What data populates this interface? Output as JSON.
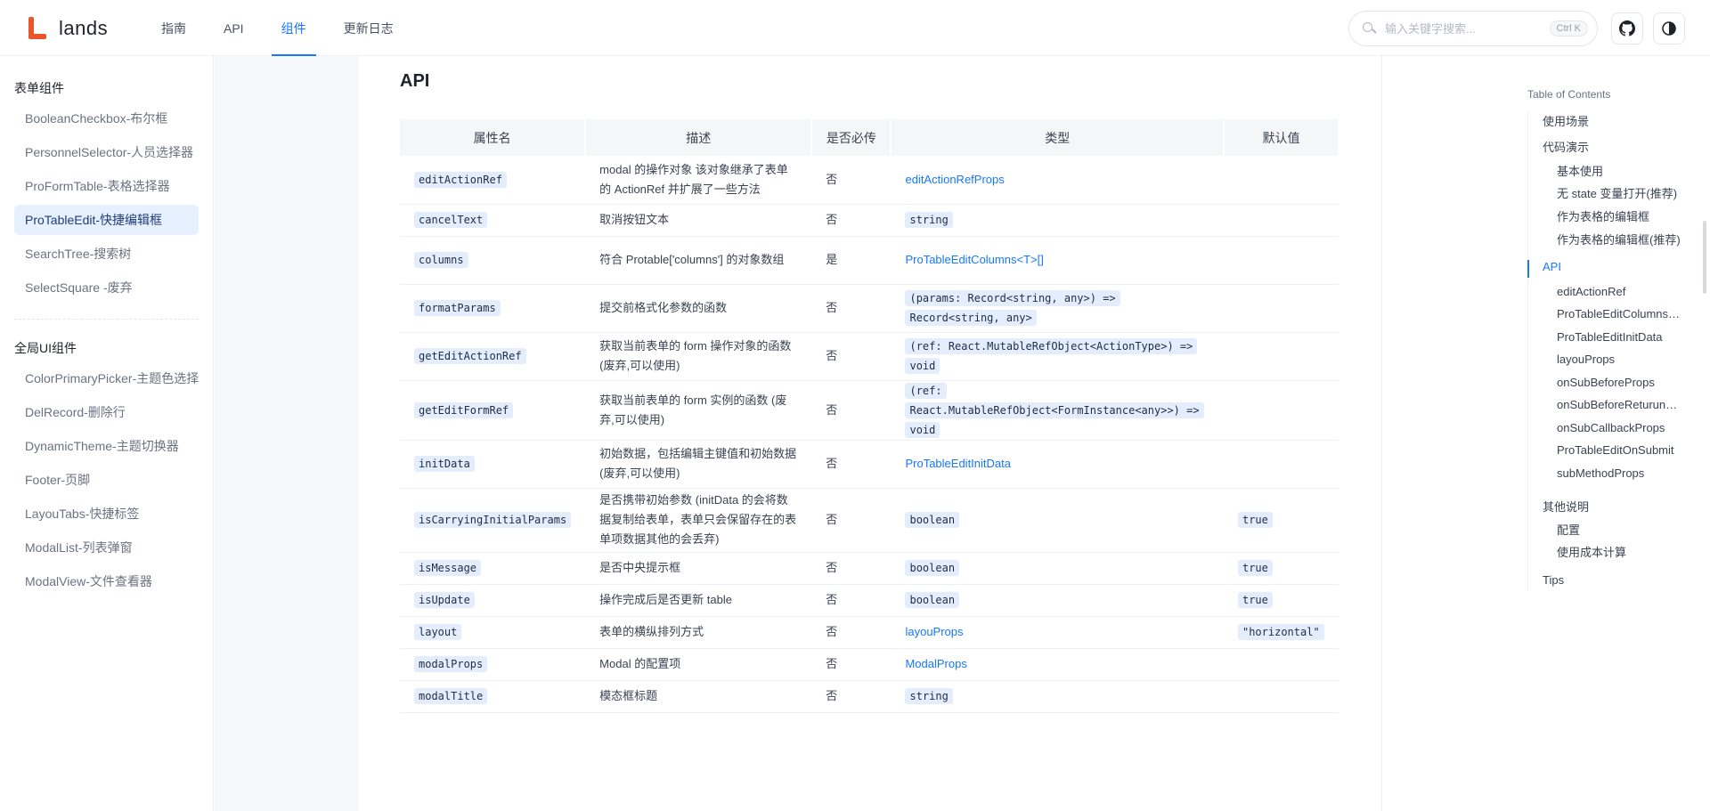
{
  "header": {
    "logo_text": "lands",
    "nav": [
      {
        "label": "指南",
        "active": false
      },
      {
        "label": "API",
        "active": false
      },
      {
        "label": "组件",
        "active": true
      },
      {
        "label": "更新日志",
        "active": false
      }
    ],
    "search_placeholder": "输入关键字搜索...",
    "search_shortcut": "Ctrl K",
    "github_icon": "github-icon",
    "theme_icon": "theme-toggle-icon"
  },
  "sidebar": {
    "group1_title": "表单组件",
    "group1_items": [
      "BooleanCheckbox-布尔框",
      "PersonnelSelector-人员选择器",
      "ProFormTable-表格选择器",
      "ProTableEdit-快捷编辑框",
      "SearchTree-搜索树",
      "SelectSquare -废弃"
    ],
    "active_item": "ProTableEdit-快捷编辑框",
    "group2_title": "全局UI组件",
    "group2_items": [
      "ColorPrimaryPicker-主题色选择器",
      "DelRecord-删除行",
      "DynamicTheme-主题切换器",
      "Footer-页脚",
      "LayouTabs-快捷标签",
      "ModalList-列表弹窗",
      "ModalView-文件查看器"
    ]
  },
  "main": {
    "section_title": "API",
    "table": {
      "headers": [
        "属性名",
        "描述",
        "是否必传",
        "类型",
        "默认值"
      ],
      "rows": [
        {
          "name": "editActionRef",
          "desc": "modal 的操作对象 该对象继承了表单的 ActionRef 并扩展了一些方法",
          "required": "否",
          "type": "editActionRefProps",
          "type_kind": "link",
          "default": ""
        },
        {
          "name": "cancelText",
          "desc": "取消按钮文本",
          "required": "否",
          "type": "string",
          "type_kind": "code",
          "default": ""
        },
        {
          "name": "columns",
          "desc": "符合 Protable['columns'] 的对象数组",
          "required": "是",
          "type": "ProTableEditColumns<T>[]",
          "type_kind": "link",
          "default": ""
        },
        {
          "name": "formatParams",
          "desc": "提交前格式化参数的函数",
          "required": "否",
          "type": "(params: Record<string, any>) => Record<string, any>",
          "type_kind": "code",
          "default": ""
        },
        {
          "name": "getEditActionRef",
          "desc": "获取当前表单的 form 操作对象的函数 (废弃,可以使用)",
          "required": "否",
          "type": "(ref: React.MutableRefObject<ActionType>) => void",
          "type_kind": "code",
          "default": ""
        },
        {
          "name": "getEditFormRef",
          "desc": "获取当前表单的 form 实例的函数 (废弃,可以使用)",
          "required": "否",
          "type": "(ref: React.MutableRefObject<FormInstance<any>>) => void",
          "type_kind": "code",
          "default": ""
        },
        {
          "name": "initData",
          "desc": "初始数据，包括编辑主键值和初始数据 (废弃,可以使用)",
          "required": "否",
          "type": "ProTableEditInitData",
          "type_kind": "link",
          "default": ""
        },
        {
          "name": "isCarryingInitialParams",
          "desc": "是否携带初始参数 (initData 的会将数据复制给表单，表单只会保留存在的表单项数据其他的会丢弃)",
          "required": "否",
          "type": "boolean",
          "type_kind": "code",
          "default": "true"
        },
        {
          "name": "isMessage",
          "desc": "是否中央提示框",
          "required": "否",
          "type": "boolean",
          "type_kind": "code",
          "default": "true"
        },
        {
          "name": "isUpdate",
          "desc": "操作完成后是否更新 table",
          "required": "否",
          "type": "boolean",
          "type_kind": "code",
          "default": "true"
        },
        {
          "name": "layout",
          "desc": "表单的横纵排列方式",
          "required": "否",
          "type": "layouProps",
          "type_kind": "link",
          "default": "\"horizontal\""
        },
        {
          "name": "modalProps",
          "desc": "Modal 的配置项",
          "required": "否",
          "type": "ModalProps",
          "type_kind": "link",
          "default": ""
        },
        {
          "name": "modalTitle",
          "desc": "模态框标题",
          "required": "否",
          "type": "string",
          "type_kind": "code",
          "default": ""
        }
      ]
    }
  },
  "toc": {
    "title": "Table of Contents",
    "items": [
      {
        "label": "使用场景",
        "level": 1
      },
      {
        "label": "代码演示",
        "level": 1
      },
      {
        "label": "基本使用",
        "level": 2
      },
      {
        "label": "无 state 变量打开(推荐)",
        "level": 2
      },
      {
        "label": "作为表格的编辑框",
        "level": 2
      },
      {
        "label": "作为表格的编辑框(推荐)",
        "level": 2
      },
      {
        "label": "API",
        "level": 1,
        "active": true
      },
      {
        "label": "editActionRef",
        "level": 2
      },
      {
        "label": "ProTableEditColumnsProps",
        "level": 2
      },
      {
        "label": "ProTableEditInitData",
        "level": 2
      },
      {
        "label": "layouProps",
        "level": 2
      },
      {
        "label": "onSubBeforeProps",
        "level": 2
      },
      {
        "label": "onSubBeforeReturunProps",
        "level": 2
      },
      {
        "label": "onSubCallbackProps",
        "level": 2
      },
      {
        "label": "ProTableEditOnSubmit",
        "level": 2
      },
      {
        "label": "subMethodProps",
        "level": 2
      },
      {
        "label": "其他说明",
        "level": 1
      },
      {
        "label": "配置",
        "level": 2
      },
      {
        "label": "使用成本计算",
        "level": 2
      },
      {
        "label": "Tips",
        "level": 1
      }
    ]
  },
  "colors": {
    "accent": "#1677ff",
    "brand": "#e8562a",
    "code_bg": "#e4edfb"
  }
}
